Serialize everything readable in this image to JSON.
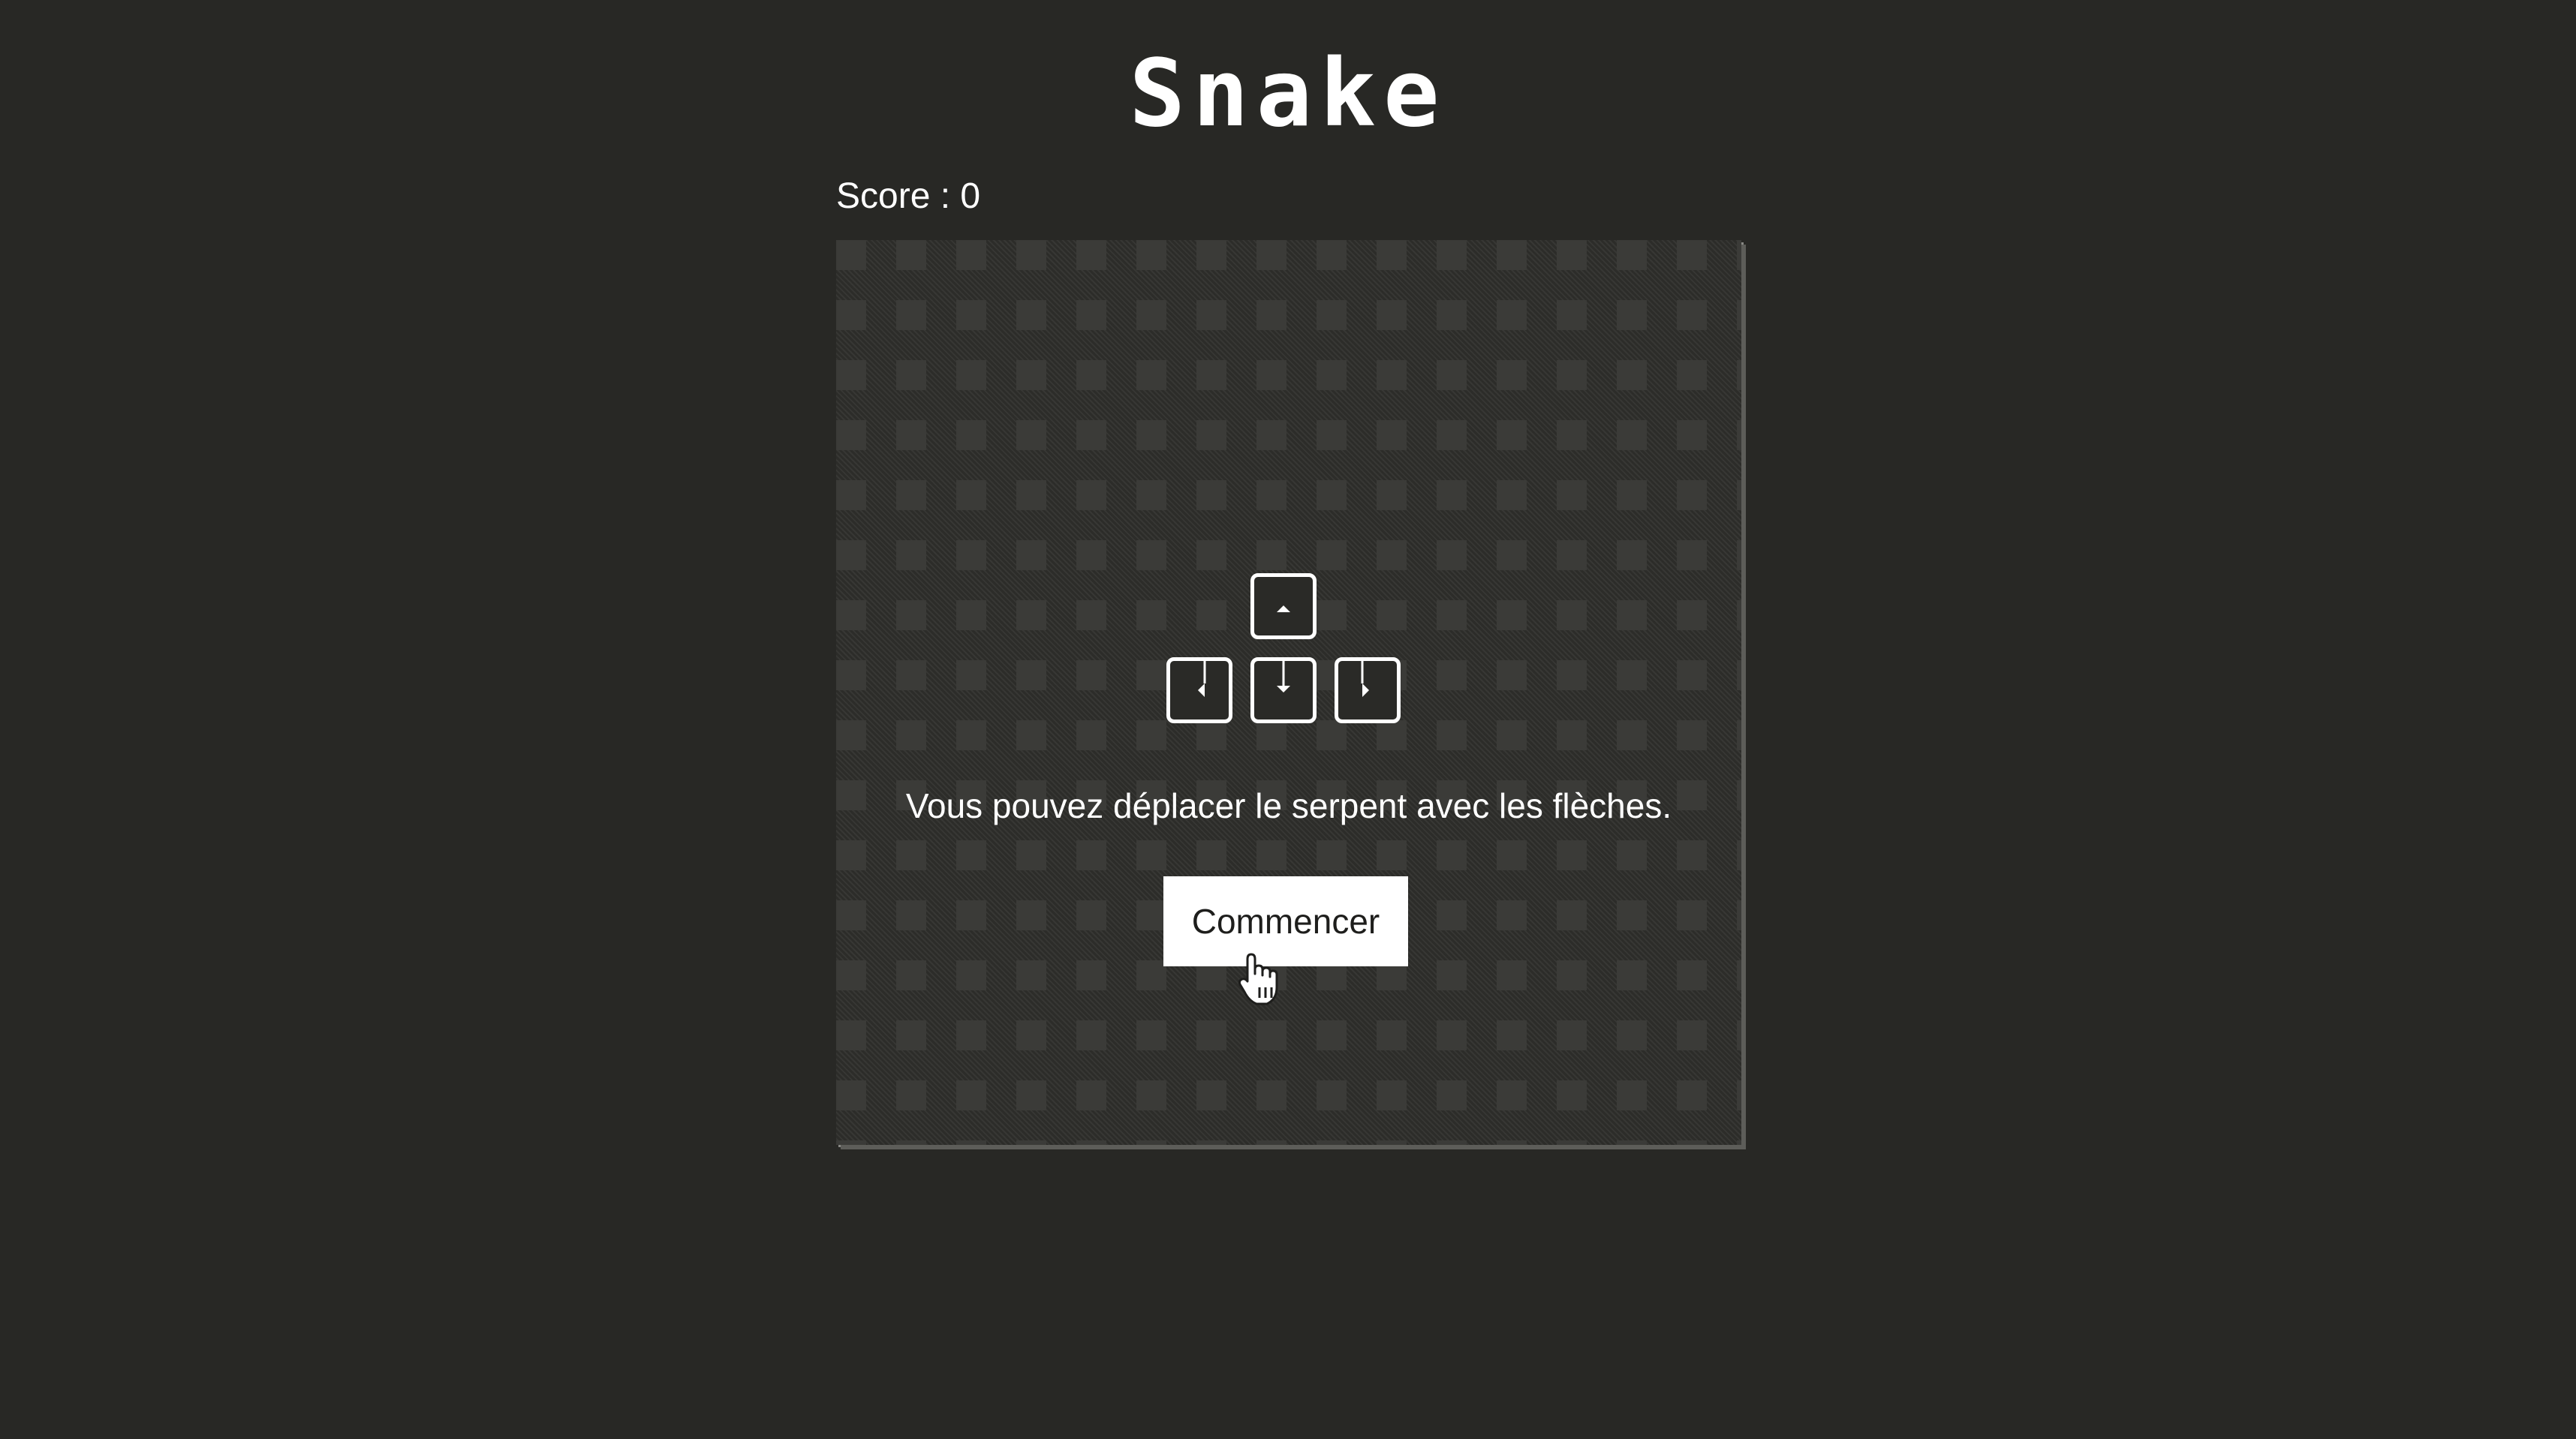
{
  "app": {
    "title": "Snake"
  },
  "score": {
    "label": "Score : 0",
    "value": 0
  },
  "board": {
    "icons": [
      "arrow-up-key-icon",
      "arrow-left-key-icon",
      "arrow-down-key-icon",
      "arrow-right-key-icon"
    ],
    "instructions": "Vous pouvez déplacer le serpent avec les flèches.",
    "start_label": "Commencer"
  },
  "colors": {
    "background": "#282825",
    "board_background": "#2c2c29",
    "grid_square": "#3e3e3b",
    "text": "#ffffff",
    "button_background": "#ffffff",
    "button_text": "#1e1e1c"
  }
}
